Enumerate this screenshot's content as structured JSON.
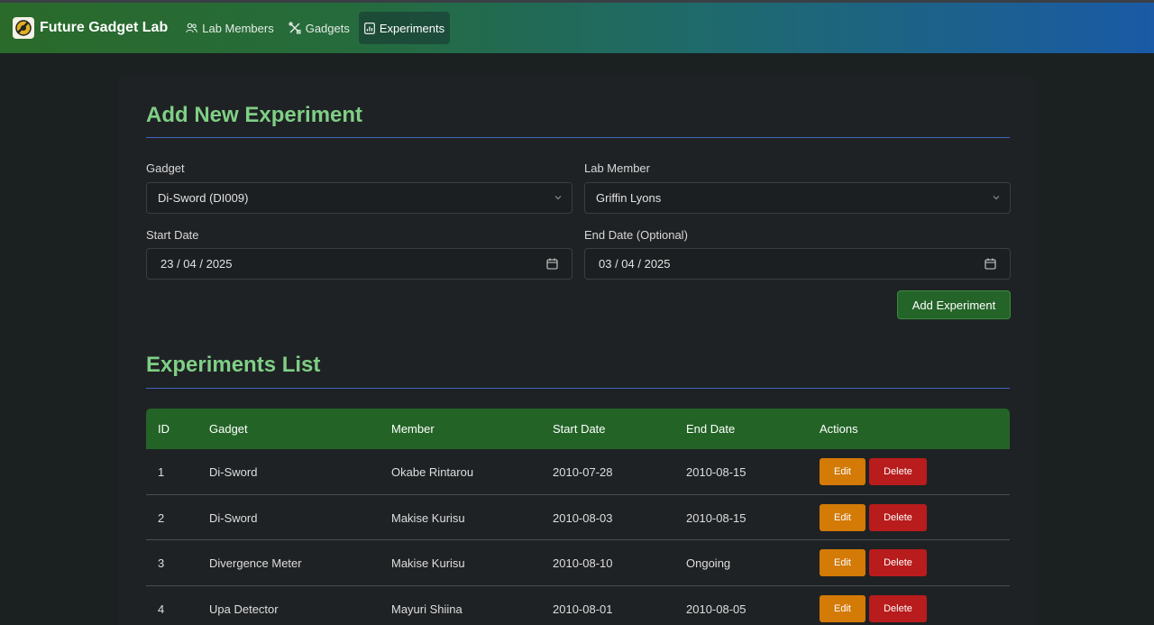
{
  "navbar": {
    "brand": "Future Gadget Lab",
    "links": [
      {
        "label": "Lab Members",
        "icon": "users-icon",
        "active": false
      },
      {
        "label": "Gadgets",
        "icon": "tools-icon",
        "active": false
      },
      {
        "label": "Experiments",
        "icon": "chart-icon",
        "active": true
      }
    ]
  },
  "form": {
    "title": "Add New Experiment",
    "gadget_label": "Gadget",
    "gadget_value": "Di-Sword (DI009)",
    "member_label": "Lab Member",
    "member_value": "Griffin Lyons",
    "start_label": "Start Date",
    "start_value": "23 / 04 / 2025",
    "end_label": "End Date (Optional)",
    "end_value": "03 / 04 / 2025",
    "submit_label": "Add Experiment"
  },
  "list": {
    "title": "Experiments List",
    "headers": [
      "ID",
      "Gadget",
      "Member",
      "Start Date",
      "End Date",
      "Actions"
    ],
    "rows": [
      {
        "id": "1",
        "gadget": "Di-Sword",
        "member": "Okabe Rintarou",
        "start": "2010-07-28",
        "end": "2010-08-15"
      },
      {
        "id": "2",
        "gadget": "Di-Sword",
        "member": "Makise Kurisu",
        "start": "2010-08-03",
        "end": "2010-08-15"
      },
      {
        "id": "3",
        "gadget": "Divergence Meter",
        "member": "Makise Kurisu",
        "start": "2010-08-10",
        "end": "Ongoing"
      },
      {
        "id": "4",
        "gadget": "Upa Detector",
        "member": "Mayuri Shiina",
        "start": "2010-08-01",
        "end": "2010-08-05"
      }
    ],
    "edit_label": "Edit",
    "delete_label": "Delete"
  },
  "colors": {
    "accent_green": "#7fcf86",
    "header_green": "#236426",
    "edit_orange": "#d37a07",
    "delete_red": "#b81c1c",
    "rule_blue": "#3f63b8"
  }
}
